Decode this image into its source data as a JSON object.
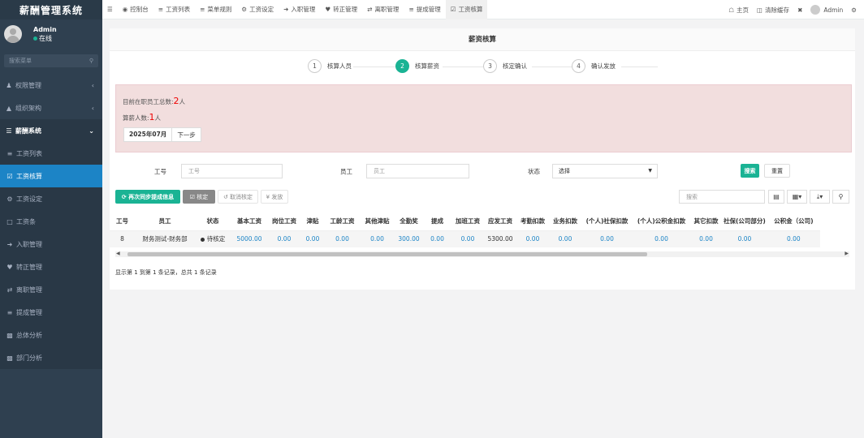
{
  "app": {
    "title": "薪酬管理系统"
  },
  "user": {
    "name": "Admin",
    "status": "在线"
  },
  "sidebar": {
    "search_placeholder": "搜索菜单",
    "items": [
      {
        "label": "权限管理",
        "icon": "users-icon"
      },
      {
        "label": "组织架构",
        "icon": "sitemap-icon"
      },
      {
        "label": "薪酬系统",
        "icon": "list-icon"
      },
      {
        "label": "工资列表",
        "icon": "list-icon"
      },
      {
        "label": "工资核算",
        "icon": "check-square-icon"
      },
      {
        "label": "工资设定",
        "icon": "gear-icon"
      },
      {
        "label": "工资条",
        "icon": "file-icon"
      },
      {
        "label": "入职管理",
        "icon": "sign-in-icon"
      },
      {
        "label": "转正管理",
        "icon": "heart-icon"
      },
      {
        "label": "离职管理",
        "icon": "exchange-icon"
      },
      {
        "label": "提成管理",
        "icon": "bars-icon"
      },
      {
        "label": "总体分析",
        "icon": "bar-chart-icon"
      },
      {
        "label": "部门分析",
        "icon": "bar-chart-icon"
      }
    ]
  },
  "topbar": {
    "tabs": [
      {
        "label": "控制台",
        "icon": "dashboard-icon"
      },
      {
        "label": "工资列表",
        "icon": "list-icon"
      },
      {
        "label": "菜单规则",
        "icon": "list-icon"
      },
      {
        "label": "工资设定",
        "icon": "gear-icon"
      },
      {
        "label": "入职管理",
        "icon": "sign-in-icon"
      },
      {
        "label": "转正管理",
        "icon": "heart-icon"
      },
      {
        "label": "离职管理",
        "icon": "exchange-icon"
      },
      {
        "label": "提成管理",
        "icon": "bars-icon"
      },
      {
        "label": "工资核算",
        "icon": "check-square-icon"
      }
    ],
    "home_label": "主页",
    "clear_cache_label": "清除缓存",
    "user_name": "Admin"
  },
  "panel": {
    "title": "薪资核算",
    "steps": [
      {
        "num": "1",
        "label": "核算人员"
      },
      {
        "num": "2",
        "label": "核算薪资"
      },
      {
        "num": "3",
        "label": "核定确认"
      },
      {
        "num": "4",
        "label": "确认发放"
      }
    ],
    "alert": {
      "total_prefix": "目前在职员工总数:",
      "total_count": "2",
      "total_unit": "人",
      "calc_prefix": "算薪人数:",
      "calc_count": "1",
      "calc_unit": "人",
      "period": "2025年07月",
      "next_label": "下一步"
    },
    "filters": {
      "job_no_label": "工号",
      "job_no_placeholder": "工号",
      "employee_label": "员工",
      "employee_placeholder": "员工",
      "status_label": "状态",
      "status_value": "选择",
      "search_btn": "搜索",
      "reset_btn": "重置"
    },
    "toolbar": {
      "sync_btn": "再次同步提成信息",
      "approve_btn": "核定",
      "cancel_btn": "取消核定",
      "pay_btn": "发放",
      "search_placeholder": "搜索"
    },
    "table": {
      "columns": [
        "工号",
        "员工",
        "状态",
        "基本工资",
        "岗位工资",
        "津贴",
        "工龄工资",
        "其他津贴",
        "全勤奖",
        "提成",
        "加班工资",
        "应发工资",
        "考勤扣款",
        "业务扣款",
        "(个人)社保扣款",
        "(个人)公积金扣款",
        "其它扣款",
        "社保(公司部分)",
        "公积金（公司)"
      ],
      "rows": [
        {
          "job_no": "8",
          "employee": "财务测试-财务部",
          "status": "待核定",
          "values": [
            "5000.00",
            "0.00",
            "0.00",
            "0.00",
            "0.00",
            "300.00",
            "0.00",
            "0.00",
            "5300.00",
            "0.00",
            "0.00",
            "0.00",
            "0.00",
            "0.00",
            "0.00",
            "0.00"
          ]
        }
      ]
    },
    "pager_info": "显示第 1 到第 1 条记录，总共 1 条记录"
  }
}
